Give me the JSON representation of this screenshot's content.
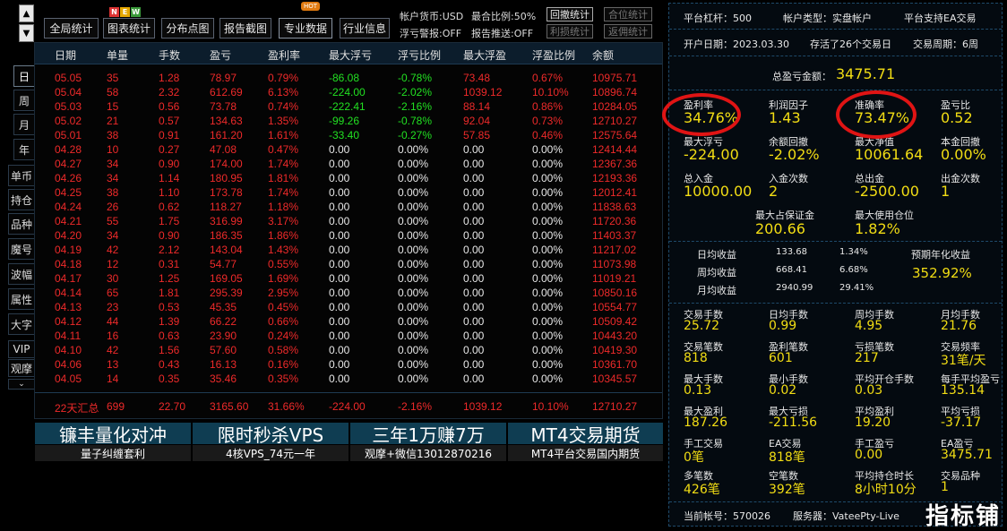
{
  "colors": {
    "up": "#ee2a2a",
    "down": "#22e022",
    "neutral": "#e8e8e8",
    "yellow": "#f2dd14",
    "panel_bg": "#040a10",
    "border": "#1e4a6a"
  },
  "sidebar": {
    "scroll_up": "▲",
    "scroll_down": "▼",
    "items": [
      "日",
      "周",
      "月",
      "年",
      "单币",
      "持仓",
      "品种",
      "魔号",
      "波幅",
      "属性",
      "大字",
      "VIP",
      "观摩"
    ],
    "more": "⌄"
  },
  "toolbar": {
    "buttons": [
      "全局统计",
      "图表统计",
      "分布点图",
      "报告截图",
      "专业数据",
      "行业信息"
    ],
    "new_badge": [
      "N",
      "E",
      "W"
    ],
    "hot_badge": "HOT"
  },
  "account_info": {
    "currency_label": "帐户货币:USD",
    "max_ratio_label": "最合比例:50%",
    "float_alert_label": "浮亏警报:OFF",
    "report_push_label": "报告推送:OFF",
    "buttons": [
      "回撤统计",
      "合位统计",
      "利损统计",
      "返佣统计"
    ]
  },
  "table": {
    "headers": [
      "日期",
      "单量",
      "手数",
      "盈亏",
      "盈利率",
      "最大浮亏",
      "浮亏比例",
      "最大浮盈",
      "浮盈比例",
      "余额"
    ],
    "rows": [
      {
        "date": "05.05",
        "orders": "35",
        "lots": "1.28",
        "pnl": "78.97",
        "rate": "0.79%",
        "max_float_loss": "-86.08",
        "float_loss_ratio": "-0.78%",
        "max_float_profit": "73.48",
        "float_profit_ratio": "0.67%",
        "balance": "10975.71"
      },
      {
        "date": "05.04",
        "orders": "58",
        "lots": "2.32",
        "pnl": "612.69",
        "rate": "6.13%",
        "max_float_loss": "-224.00",
        "float_loss_ratio": "-2.02%",
        "max_float_profit": "1039.12",
        "float_profit_ratio": "10.10%",
        "balance": "10896.74"
      },
      {
        "date": "05.03",
        "orders": "15",
        "lots": "0.56",
        "pnl": "73.78",
        "rate": "0.74%",
        "max_float_loss": "-222.41",
        "float_loss_ratio": "-2.16%",
        "max_float_profit": "88.14",
        "float_profit_ratio": "0.86%",
        "balance": "10284.05"
      },
      {
        "date": "05.02",
        "orders": "21",
        "lots": "0.57",
        "pnl": "134.63",
        "rate": "1.35%",
        "max_float_loss": "-99.26",
        "float_loss_ratio": "-0.78%",
        "max_float_profit": "92.04",
        "float_profit_ratio": "0.73%",
        "balance": "12710.27"
      },
      {
        "date": "05.01",
        "orders": "38",
        "lots": "0.91",
        "pnl": "161.20",
        "rate": "1.61%",
        "max_float_loss": "-33.40",
        "float_loss_ratio": "-0.27%",
        "max_float_profit": "57.85",
        "float_profit_ratio": "0.46%",
        "balance": "12575.64"
      },
      {
        "date": "04.28",
        "orders": "10",
        "lots": "0.27",
        "pnl": "47.08",
        "rate": "0.47%",
        "max_float_loss": "0.00",
        "float_loss_ratio": "0.00%",
        "max_float_profit": "0.00",
        "float_profit_ratio": "0.00%",
        "balance": "12414.44"
      },
      {
        "date": "04.27",
        "orders": "34",
        "lots": "0.90",
        "pnl": "174.00",
        "rate": "1.74%",
        "max_float_loss": "0.00",
        "float_loss_ratio": "0.00%",
        "max_float_profit": "0.00",
        "float_profit_ratio": "0.00%",
        "balance": "12367.36"
      },
      {
        "date": "04.26",
        "orders": "34",
        "lots": "1.14",
        "pnl": "180.95",
        "rate": "1.81%",
        "max_float_loss": "0.00",
        "float_loss_ratio": "0.00%",
        "max_float_profit": "0.00",
        "float_profit_ratio": "0.00%",
        "balance": "12193.36"
      },
      {
        "date": "04.25",
        "orders": "38",
        "lots": "1.10",
        "pnl": "173.78",
        "rate": "1.74%",
        "max_float_loss": "0.00",
        "float_loss_ratio": "0.00%",
        "max_float_profit": "0.00",
        "float_profit_ratio": "0.00%",
        "balance": "12012.41"
      },
      {
        "date": "04.24",
        "orders": "26",
        "lots": "0.62",
        "pnl": "118.27",
        "rate": "1.18%",
        "max_float_loss": "0.00",
        "float_loss_ratio": "0.00%",
        "max_float_profit": "0.00",
        "float_profit_ratio": "0.00%",
        "balance": "11838.63"
      },
      {
        "date": "04.21",
        "orders": "55",
        "lots": "1.75",
        "pnl": "316.99",
        "rate": "3.17%",
        "max_float_loss": "0.00",
        "float_loss_ratio": "0.00%",
        "max_float_profit": "0.00",
        "float_profit_ratio": "0.00%",
        "balance": "11720.36"
      },
      {
        "date": "04.20",
        "orders": "34",
        "lots": "0.90",
        "pnl": "186.35",
        "rate": "1.86%",
        "max_float_loss": "0.00",
        "float_loss_ratio": "0.00%",
        "max_float_profit": "0.00",
        "float_profit_ratio": "0.00%",
        "balance": "11403.37"
      },
      {
        "date": "04.19",
        "orders": "42",
        "lots": "2.12",
        "pnl": "143.04",
        "rate": "1.43%",
        "max_float_loss": "0.00",
        "float_loss_ratio": "0.00%",
        "max_float_profit": "0.00",
        "float_profit_ratio": "0.00%",
        "balance": "11217.02"
      },
      {
        "date": "04.18",
        "orders": "12",
        "lots": "0.31",
        "pnl": "54.77",
        "rate": "0.55%",
        "max_float_loss": "0.00",
        "float_loss_ratio": "0.00%",
        "max_float_profit": "0.00",
        "float_profit_ratio": "0.00%",
        "balance": "11073.98"
      },
      {
        "date": "04.17",
        "orders": "30",
        "lots": "1.25",
        "pnl": "169.05",
        "rate": "1.69%",
        "max_float_loss": "0.00",
        "float_loss_ratio": "0.00%",
        "max_float_profit": "0.00",
        "float_profit_ratio": "0.00%",
        "balance": "11019.21"
      },
      {
        "date": "04.14",
        "orders": "65",
        "lots": "1.81",
        "pnl": "295.39",
        "rate": "2.95%",
        "max_float_loss": "0.00",
        "float_loss_ratio": "0.00%",
        "max_float_profit": "0.00",
        "float_profit_ratio": "0.00%",
        "balance": "10850.16"
      },
      {
        "date": "04.13",
        "orders": "23",
        "lots": "0.53",
        "pnl": "45.35",
        "rate": "0.45%",
        "max_float_loss": "0.00",
        "float_loss_ratio": "0.00%",
        "max_float_profit": "0.00",
        "float_profit_ratio": "0.00%",
        "balance": "10554.77"
      },
      {
        "date": "04.12",
        "orders": "44",
        "lots": "1.39",
        "pnl": "66.22",
        "rate": "0.66%",
        "max_float_loss": "0.00",
        "float_loss_ratio": "0.00%",
        "max_float_profit": "0.00",
        "float_profit_ratio": "0.00%",
        "balance": "10509.42"
      },
      {
        "date": "04.11",
        "orders": "16",
        "lots": "0.63",
        "pnl": "23.90",
        "rate": "0.24%",
        "max_float_loss": "0.00",
        "float_loss_ratio": "0.00%",
        "max_float_profit": "0.00",
        "float_profit_ratio": "0.00%",
        "balance": "10443.20"
      },
      {
        "date": "04.10",
        "orders": "42",
        "lots": "1.56",
        "pnl": "57.60",
        "rate": "0.58%",
        "max_float_loss": "0.00",
        "float_loss_ratio": "0.00%",
        "max_float_profit": "0.00",
        "float_profit_ratio": "0.00%",
        "balance": "10419.30"
      },
      {
        "date": "04.06",
        "orders": "13",
        "lots": "0.43",
        "pnl": "16.13",
        "rate": "0.16%",
        "max_float_loss": "0.00",
        "float_loss_ratio": "0.00%",
        "max_float_profit": "0.00",
        "float_profit_ratio": "0.00%",
        "balance": "10361.70"
      },
      {
        "date": "04.05",
        "orders": "14",
        "lots": "0.35",
        "pnl": "35.46",
        "rate": "0.35%",
        "max_float_loss": "0.00",
        "float_loss_ratio": "0.00%",
        "max_float_profit": "0.00",
        "float_profit_ratio": "0.00%",
        "balance": "10345.57"
      }
    ],
    "summary": {
      "label": "22天汇总",
      "orders": "699",
      "lots": "22.70",
      "pnl": "3165.60",
      "rate": "31.66%",
      "max_float_loss": "-224.00",
      "float_loss_ratio": "-2.16%",
      "max_float_profit": "1039.12",
      "float_profit_ratio": "10.10%",
      "balance": "12710.27"
    }
  },
  "banners": [
    {
      "title": "镰丰量化对冲",
      "sub": "量子纠缠套利"
    },
    {
      "title": "限时秒杀VPS",
      "sub": "4核VPS_74元一年"
    },
    {
      "title": "三年1万赚7万",
      "sub": "观摩+微信13012870216"
    },
    {
      "title": "MT4交易期货",
      "sub": "MT4平台交易国内期货"
    }
  ],
  "stats": {
    "platform_leverage": "平台杠杆：500",
    "account_type": "帐户类型：实盘帐户",
    "ea_support": "平台支持EA交易",
    "open_date": "开户日期：2023.03.30",
    "survived": "存活了26个交易日",
    "trade_period": "交易周期：6周",
    "total_pnl_label": "总盈亏金额：",
    "total_pnl": "3475.71",
    "grid1": [
      {
        "label": "盈利率",
        "value": "34.76%"
      },
      {
        "label": "利润因子",
        "value": "1.43"
      },
      {
        "label": "准确率",
        "value": "73.47%"
      },
      {
        "label": "盈亏比",
        "value": "0.52"
      },
      {
        "label": "最大浮亏",
        "value": "-224.00"
      },
      {
        "label": "余额回撤",
        "value": "-2.02%"
      },
      {
        "label": "最大净值",
        "value": "10061.64"
      },
      {
        "label": "本金回撤",
        "value": "0.00%"
      },
      {
        "label": "总入金",
        "value": "10000.00"
      },
      {
        "label": "入金次数",
        "value": "2"
      },
      {
        "label": "总出金",
        "value": "-2500.00"
      },
      {
        "label": "出金次数",
        "value": "1"
      }
    ],
    "margin": [
      {
        "label": "最大占保证金",
        "value": "200.66"
      },
      {
        "label": "最大使用仓位",
        "value": "1.82%"
      }
    ],
    "periodic": [
      {
        "label": "日均收益",
        "amount": "133.68",
        "pct": "1.34%"
      },
      {
        "label": "周均收益",
        "amount": "668.41",
        "pct": "6.68%"
      },
      {
        "label": "月均收益",
        "amount": "2940.99",
        "pct": "29.41%"
      }
    ],
    "annual_label": "预期年化收益",
    "annual_value": "352.92%",
    "grid2": [
      {
        "label": "交易手数",
        "value": "25.72"
      },
      {
        "label": "日均手数",
        "value": "0.99"
      },
      {
        "label": "周均手数",
        "value": "4.95"
      },
      {
        "label": "月均手数",
        "value": "21.76"
      },
      {
        "label": "交易笔数",
        "value": "818"
      },
      {
        "label": "盈利笔数",
        "value": "601"
      },
      {
        "label": "亏损笔数",
        "value": "217"
      },
      {
        "label": "交易频率",
        "value": "31笔/天"
      },
      {
        "label": "最大手数",
        "value": "0.13"
      },
      {
        "label": "最小手数",
        "value": "0.02"
      },
      {
        "label": "平均开仓手数",
        "value": "0.03"
      },
      {
        "label": "每手平均盈亏",
        "value": "135.14"
      },
      {
        "label": "最大盈利",
        "value": "187.26"
      },
      {
        "label": "最大亏损",
        "value": "-211.56"
      },
      {
        "label": "平均盈利",
        "value": "19.20"
      },
      {
        "label": "平均亏损",
        "value": "-37.17"
      },
      {
        "label": "手工交易",
        "value": "0笔"
      },
      {
        "label": "EA交易",
        "value": "818笔"
      },
      {
        "label": "手工盈亏",
        "value": "0.00"
      },
      {
        "label": "EA盈亏",
        "value": "3475.71"
      },
      {
        "label": "多笔数",
        "value": "426笔"
      },
      {
        "label": "空笔数",
        "value": "392笔"
      },
      {
        "label": "平均持仓时长",
        "value": "8小时10分"
      },
      {
        "label": "交易品种",
        "value": "1"
      }
    ],
    "current_account": "当前帐号：570026",
    "server": "服务器：VateePty-Live"
  },
  "watermark": "指标铺"
}
